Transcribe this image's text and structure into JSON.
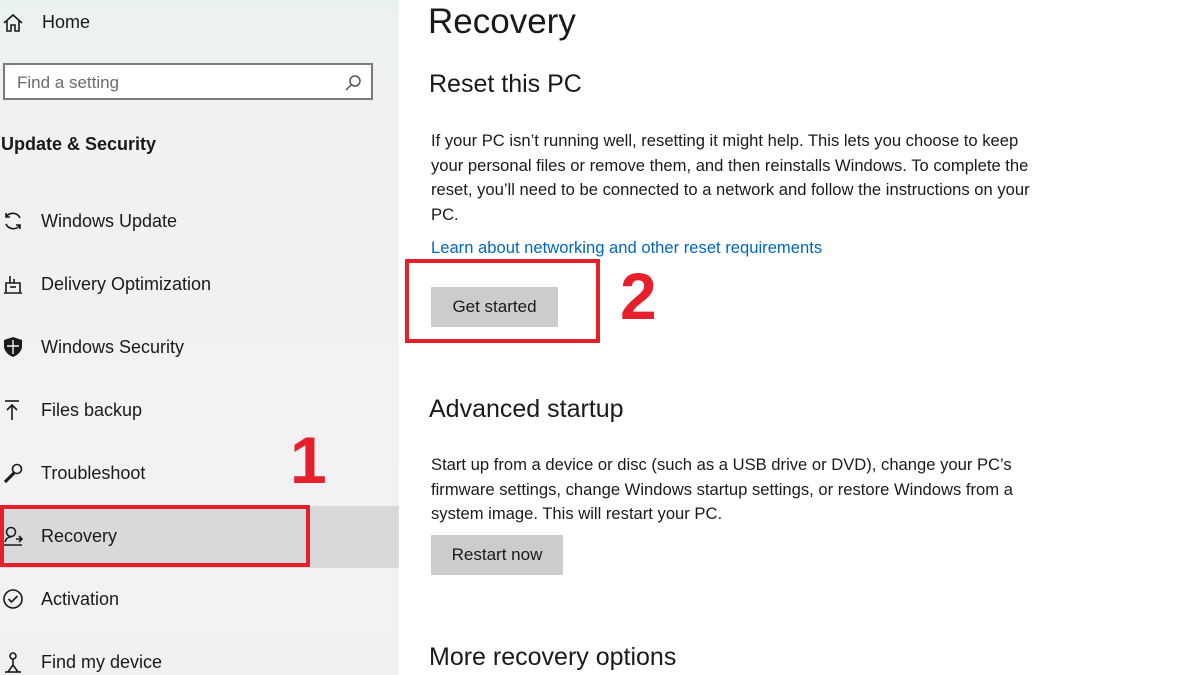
{
  "sidebar": {
    "home_label": "Home",
    "search_placeholder": "Find a setting",
    "section_title": "Update & Security",
    "items": [
      {
        "label": "Windows Update"
      },
      {
        "label": "Delivery Optimization"
      },
      {
        "label": "Windows Security"
      },
      {
        "label": "Files backup"
      },
      {
        "label": "Troubleshoot"
      },
      {
        "label": "Recovery",
        "selected": true
      },
      {
        "label": "Activation"
      },
      {
        "label": "Find my device"
      }
    ]
  },
  "annotations": {
    "step1": "1",
    "step2": "2",
    "color": "#e5202b"
  },
  "main": {
    "title": "Recovery",
    "reset": {
      "heading": "Reset this PC",
      "description": "If your PC isn’t running well, resetting it might help. This lets you choose to keep your personal files or remove them, and then reinstalls Windows. To complete the reset, you’ll need to be connected to a network and follow the instructions on your PC.",
      "link": "Learn about networking and other reset requirements",
      "button": "Get started"
    },
    "advanced": {
      "heading": "Advanced startup",
      "description": "Start up from a device or disc (such as a USB drive or DVD), change your PC’s firmware settings, change Windows startup settings, or restore Windows from a system image. This will restart your PC.",
      "button": "Restart now"
    },
    "more": {
      "heading": "More recovery options"
    }
  },
  "colors": {
    "link": "#0067c0",
    "button_bg": "#cccccc",
    "selected_bg": "#d9d9d9"
  }
}
